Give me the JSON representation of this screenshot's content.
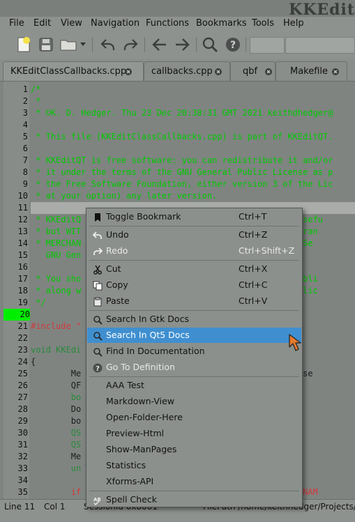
{
  "window": {
    "title": "KKEdit"
  },
  "menubar": {
    "items": [
      "File",
      "Edit",
      "View",
      "Navigation",
      "Functions",
      "Bookmarks",
      "Tools",
      "Help"
    ]
  },
  "toolbar": {
    "icons": [
      "new-file-icon",
      "save-icon",
      "open-folder-icon",
      "dropdown-arrow-icon",
      "undo-icon",
      "redo-icon",
      "back-icon",
      "forward-icon",
      "find-icon",
      "help-icon"
    ]
  },
  "tabs": [
    {
      "label": "KKEditClassCallbacks.cpp",
      "active": true
    },
    {
      "label": "callbacks.cpp",
      "active": false
    },
    {
      "label": "qbf",
      "active": false
    },
    {
      "label": "Makefile",
      "active": false
    }
  ],
  "editor": {
    "current_line": 20,
    "lines": [
      {
        "n": "1",
        "text": "/*",
        "kind": "comment"
      },
      {
        "n": "2",
        "text": " *",
        "kind": "comment"
      },
      {
        "n": "3",
        "text": " * ©K. D. Hedger. Thu 23 Dec 20:38:31 GMT 2021 keithdhedger@",
        "kind": "comment"
      },
      {
        "n": "4",
        "text": "",
        "kind": "comment"
      },
      {
        "n": "5",
        "text": " * This file (KKEditClassCallbacks.cpp) is part of KKEditQT.",
        "kind": "comment"
      },
      {
        "n": "6",
        "text": "",
        "kind": "comment"
      },
      {
        "n": "7",
        "text": " * KKEditQT is free software: you can redistribute it and/or",
        "kind": "comment"
      },
      {
        "n": "8",
        "text": " * it under the terms of the GNU General Public License as p",
        "kind": "comment"
      },
      {
        "n": "9",
        "text": " * the Free Software Foundation, either version 3 of the Lic",
        "kind": "comment"
      },
      {
        "n": "10",
        "text": " * at your option) any later version.",
        "kind": "comment"
      },
      {
        "n": "11",
        "text": "",
        "kind": "comment"
      },
      {
        "n": "12",
        "text": " * KKEditQ                                      l be usefu",
        "kind": "comment"
      },
      {
        "n": "13",
        "text": " * but WIT                                     ied warran",
        "kind": "comment"
      },
      {
        "n": "14",
        "text": " * MERCHAN                                     POSE.  Se",
        "kind": "comment"
      },
      {
        "n": "15",
        "text": "   GNU Gen",
        "kind": "comment"
      },
      {
        "n": "16",
        "text": "",
        "kind": "comment"
      },
      {
        "n": "17",
        "text": " * You sho                                     eral Publi",
        "kind": "comment"
      },
      {
        "n": "18",
        "text": " * along w                                     nu.org/lic",
        "kind": "comment"
      },
      {
        "n": "19",
        "text": " */",
        "kind": "comment"
      },
      {
        "n": "20",
        "text": "",
        "kind": "plain"
      },
      {
        "n": "21",
        "text": "#include \"",
        "kind": "inc"
      },
      {
        "n": "22",
        "text": "",
        "kind": "plain"
      },
      {
        "n": "23",
        "text": "void KKEdi",
        "kind": "keyword"
      },
      {
        "n": "24",
        "text": "{",
        "kind": "plain"
      },
      {
        "n": "25",
        "text": "        Me                                    Class*>(se",
        "kind": "plain"
      },
      {
        "n": "26",
        "text": "        QF",
        "kind": "plain"
      },
      {
        "n": "27",
        "text": "        bo",
        "kind": "keyword"
      },
      {
        "n": "28",
        "text": "        Do",
        "kind": "plain"
      },
      {
        "n": "29",
        "text": "        bo",
        "kind": "plain"
      },
      {
        "n": "30",
        "text": "        QS",
        "kind": "keyword"
      },
      {
        "n": "31",
        "text": "        QS",
        "kind": "keyword"
      },
      {
        "n": "32",
        "text": "        Me",
        "kind": "plain"
      },
      {
        "n": "33",
        "text": "        un                                    ID();",
        "kind": "keyword"
      },
      {
        "n": "34",
        "text": "",
        "kind": "plain"
      },
      {
        "n": "35",
        "text": "        if                                    SIONMENUNAM",
        "kind": "inc"
      }
    ]
  },
  "statusbar": {
    "line": "Line 11",
    "col": "Col 1",
    "session": "SessionId 0x8001",
    "filepath": "FilePath /home/keithhedger/Projects/"
  },
  "context_menu": {
    "items": [
      {
        "label": "Toggle Bookmark",
        "shortcut": "Ctrl+T",
        "icon": "bookmark-icon",
        "state": "normal"
      },
      {
        "sep": true
      },
      {
        "label": "Undo",
        "shortcut": "Ctrl+Z",
        "icon": "undo-icon",
        "state": "normal"
      },
      {
        "label": "Redo",
        "shortcut": "Ctrl+Shift+Z",
        "icon": "redo-icon",
        "state": "disabled"
      },
      {
        "sep": true
      },
      {
        "label": "Cut",
        "shortcut": "Ctrl+X",
        "icon": "cut-icon",
        "state": "normal"
      },
      {
        "label": "Copy",
        "shortcut": "Ctrl+C",
        "icon": "copy-icon",
        "state": "normal"
      },
      {
        "label": "Paste",
        "shortcut": "Ctrl+V",
        "icon": "paste-icon",
        "state": "normal"
      },
      {
        "sep": true
      },
      {
        "label": "Search In Gtk Docs",
        "shortcut": "",
        "icon": "search-icon",
        "state": "normal"
      },
      {
        "label": "Search In Qt5 Docs",
        "shortcut": "",
        "icon": "search-icon",
        "state": "highlighted"
      },
      {
        "label": "Find In Documentation",
        "shortcut": "",
        "icon": "search-icon",
        "state": "normal"
      },
      {
        "label": "Go To Definition",
        "shortcut": "",
        "icon": "help-icon",
        "state": "disabled"
      },
      {
        "sep": true
      },
      {
        "label": "AAA Test",
        "shortcut": "",
        "icon": "",
        "state": "normal"
      },
      {
        "label": "Markdown-View",
        "shortcut": "",
        "icon": "",
        "state": "normal"
      },
      {
        "label": "Open-Folder-Here",
        "shortcut": "",
        "icon": "",
        "state": "normal"
      },
      {
        "label": "Preview-Html",
        "shortcut": "",
        "icon": "",
        "state": "normal"
      },
      {
        "label": "Show-ManPages",
        "shortcut": "",
        "icon": "",
        "state": "normal"
      },
      {
        "label": "Statistics",
        "shortcut": "",
        "icon": "",
        "state": "normal"
      },
      {
        "label": "Xforms-API",
        "shortcut": "",
        "icon": "",
        "state": "normal"
      },
      {
        "sep": true
      },
      {
        "label": "Spell Check",
        "shortcut": "",
        "icon": "spellcheck-icon",
        "state": "normal"
      }
    ]
  },
  "colors": {
    "highlight": "#3f8fd0",
    "current_line": "#00ee00",
    "comment": "#00c800",
    "keyword": "#2a8a3a",
    "include": "#d03a3a",
    "cursor": "#e87a2a"
  }
}
